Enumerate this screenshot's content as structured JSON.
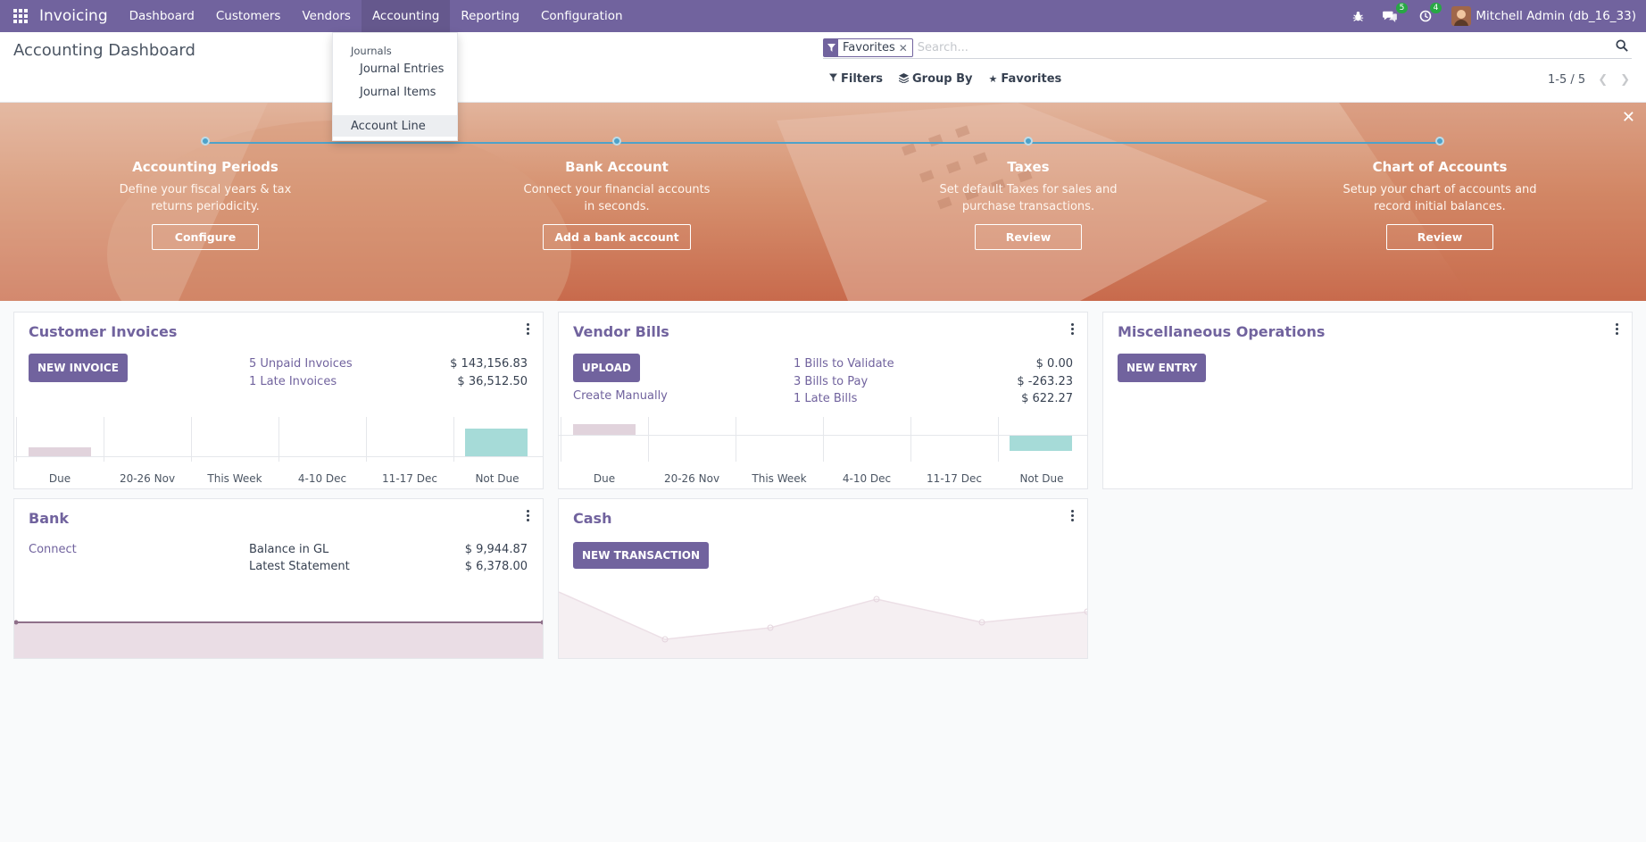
{
  "navbar": {
    "brand": "Invoicing",
    "menus": [
      "Dashboard",
      "Customers",
      "Vendors",
      "Accounting",
      "Reporting",
      "Configuration"
    ],
    "messages_count": "5",
    "activities_count": "4",
    "user": "Mitchell Admin (db_16_33)"
  },
  "dropdown": {
    "section": "Journals",
    "items": [
      "Journal Entries",
      "Journal Items"
    ],
    "extra_item": "Account Line"
  },
  "control_panel": {
    "title": "Accounting Dashboard",
    "facet": "Favorites",
    "search_placeholder": "Search...",
    "filters_label": "Filters",
    "groupby_label": "Group By",
    "favorites_label": "Favorites",
    "pager": "1-5 / 5"
  },
  "banner": {
    "steps": [
      {
        "title": "Accounting Periods",
        "desc": "Define your fiscal years & tax returns periodicity.",
        "button": "Configure"
      },
      {
        "title": "Bank Account",
        "desc": "Connect your financial accounts in seconds.",
        "button": "Add a bank account"
      },
      {
        "title": "Taxes",
        "desc": "Set default Taxes for sales and purchase transactions.",
        "button": "Review"
      },
      {
        "title": "Chart of Accounts",
        "desc": "Setup your chart of accounts and record initial balances.",
        "button": "Review"
      }
    ]
  },
  "customer_invoices": {
    "title": "Customer Invoices",
    "button": "NEW INVOICE",
    "stats": [
      {
        "label": "5 Unpaid Invoices",
        "value": "$ 143,156.83"
      },
      {
        "label": "1 Late Invoices",
        "value": "$ 36,512.50"
      }
    ],
    "chart_labels": [
      "Due",
      "20-26 Nov",
      "This Week",
      "4-10 Dec",
      "11-17 Dec",
      "Not Due"
    ]
  },
  "vendor_bills": {
    "title": "Vendor Bills",
    "button": "UPLOAD",
    "secondary": "Create Manually",
    "stats": [
      {
        "label": "1 Bills to Validate",
        "value": "$ 0.00"
      },
      {
        "label": "3 Bills to Pay",
        "value": "$ -263.23"
      },
      {
        "label": "1 Late Bills",
        "value": "$ 622.27"
      }
    ],
    "chart_labels": [
      "Due",
      "20-26 Nov",
      "This Week",
      "4-10 Dec",
      "11-17 Dec",
      "Not Due"
    ]
  },
  "misc_operations": {
    "title": "Miscellaneous Operations",
    "button": "NEW ENTRY"
  },
  "bank": {
    "title": "Bank",
    "link": "Connect",
    "stats": [
      {
        "label": "Balance in GL",
        "value": "$ 9,944.87"
      },
      {
        "label": "Latest Statement",
        "value": "$ 6,378.00"
      }
    ]
  },
  "cash": {
    "title": "Cash",
    "button": "NEW TRANSACTION"
  },
  "colors": {
    "brand": "#71639e",
    "due_bar": "#e1d3dc",
    "not_due_bar": "#a6dbd8",
    "accent_line": "#4ea2c9"
  }
}
